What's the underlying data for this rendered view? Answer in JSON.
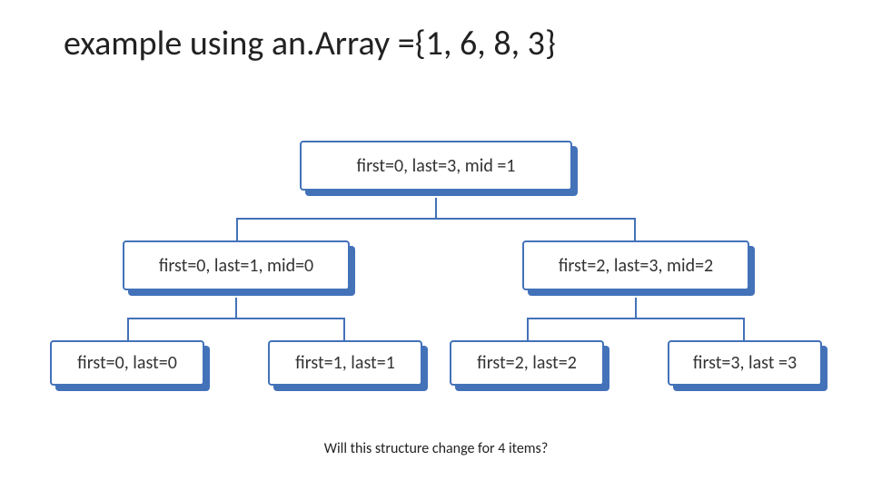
{
  "title": "example using an.Array ={1, 6, 8, 3}",
  "nodes": {
    "root": "first=0, last=3, mid =1",
    "l": "first=0, last=1, mid=0",
    "r": "first=2, last=3, mid=2",
    "ll": "first=0, last=0",
    "lr": "first=1, last=1",
    "rl": "first=2, last=2",
    "rr": "first=3, last =3"
  },
  "footnote": "Will this structure change for 4 items?"
}
